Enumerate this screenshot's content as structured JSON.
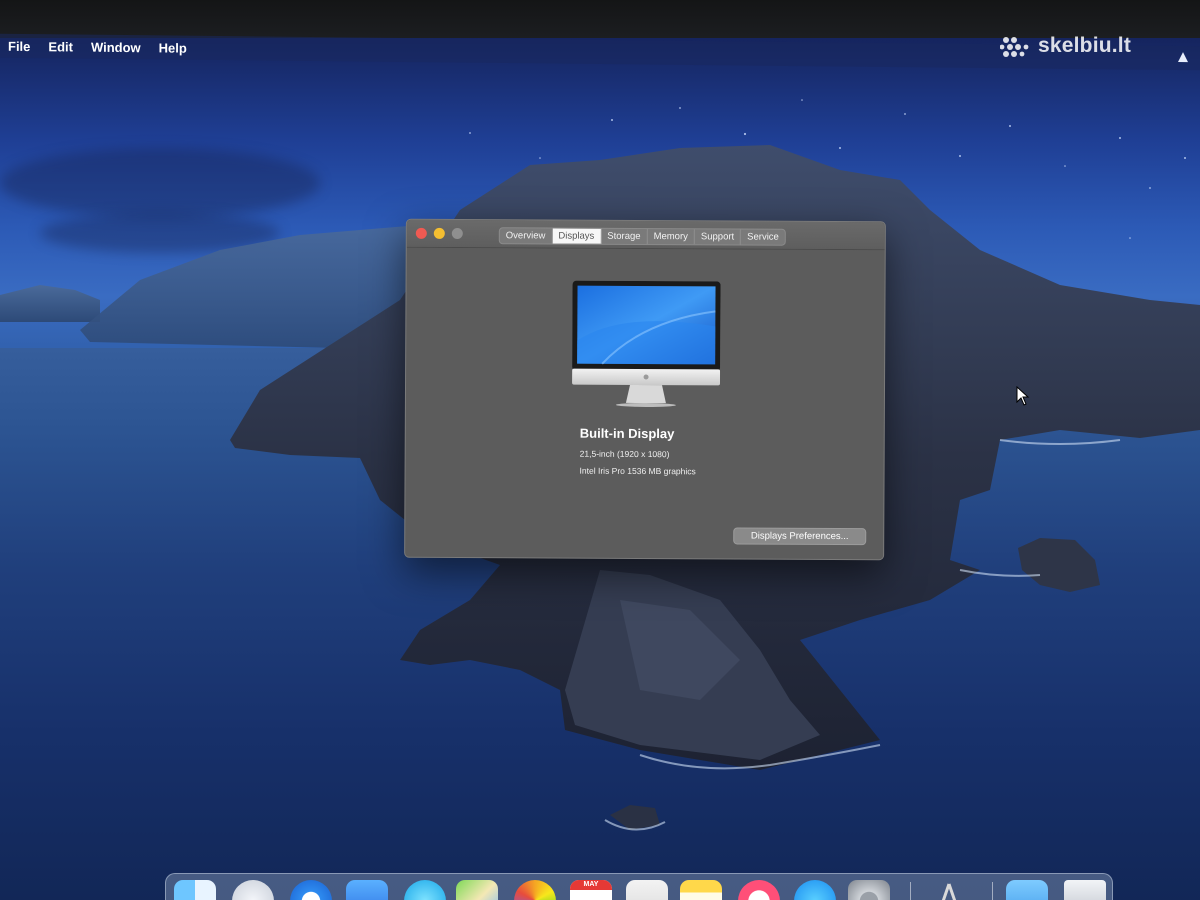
{
  "watermark": {
    "text": "skelbiu.lt"
  },
  "menubar": {
    "items": [
      {
        "label": "File"
      },
      {
        "label": "Edit"
      },
      {
        "label": "Window"
      },
      {
        "label": "Help"
      }
    ]
  },
  "about_window": {
    "tabs": [
      {
        "label": "Overview",
        "selected": false
      },
      {
        "label": "Displays",
        "selected": true
      },
      {
        "label": "Storage",
        "selected": false
      },
      {
        "label": "Memory",
        "selected": false
      },
      {
        "label": "Support",
        "selected": false
      },
      {
        "label": "Service",
        "selected": false
      }
    ],
    "display_name": "Built-in Display",
    "display_size": "21,5-inch (1920 x 1080)",
    "graphics": "Intel Iris Pro 1536 MB graphics",
    "preferences_button": "Displays Preferences..."
  },
  "dock": {
    "items": [
      {
        "icon": "finder-icon"
      },
      {
        "icon": "launchpad-icon"
      },
      {
        "icon": "safari-icon"
      },
      {
        "icon": "mail-icon"
      },
      {
        "icon": "facetime-icon"
      },
      {
        "icon": "maps-icon"
      },
      {
        "icon": "photos-icon"
      },
      {
        "icon": "calendar-icon"
      },
      {
        "icon": "contacts-icon"
      },
      {
        "icon": "notes-icon"
      },
      {
        "icon": "music-icon"
      },
      {
        "icon": "app-store-icon"
      },
      {
        "icon": "system-preferences-icon"
      },
      {
        "icon": "instruments-icon"
      },
      {
        "icon": "downloads-folder-icon"
      },
      {
        "icon": "trash-icon"
      }
    ],
    "calendar_month": "MAY"
  },
  "colors": {
    "close": "#f05a52",
    "minimize": "#f4be31",
    "zoom_disabled": "#8f8f8f",
    "window_bg": "#5c5c5c"
  }
}
